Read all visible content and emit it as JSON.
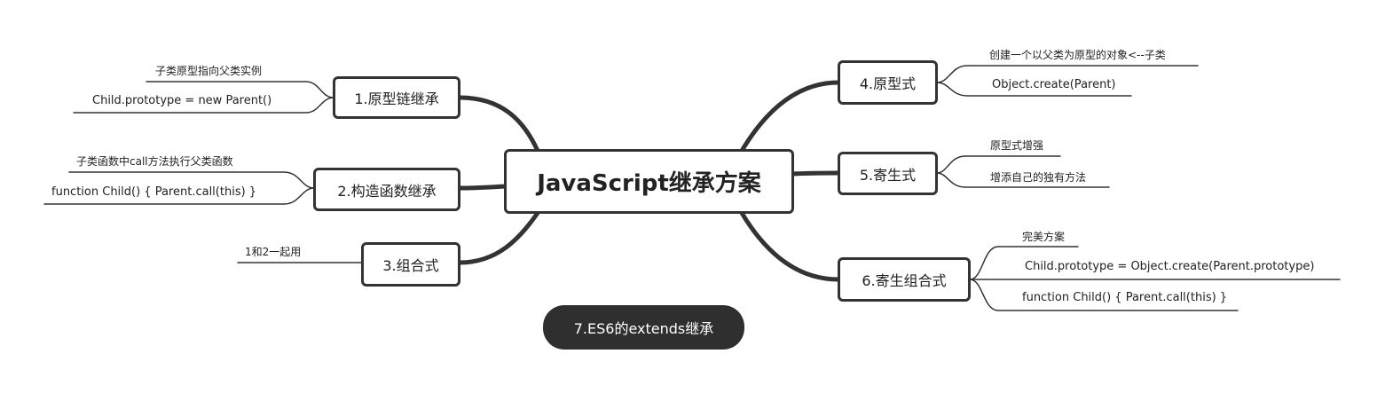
{
  "root": {
    "label": "JavaScript继承方案"
  },
  "branches": {
    "b1": {
      "label": "1.原型链继承",
      "leaves": [
        "子类原型指向父类实例",
        "Child.prototype = new Parent()"
      ]
    },
    "b2": {
      "label": "2.构造函数继承",
      "leaves": [
        "子类函数中call方法执行父类函数",
        "function Child() { Parent.call(this) }"
      ]
    },
    "b3": {
      "label": "3.组合式",
      "leaves": [
        "1和2一起用"
      ]
    },
    "b4": {
      "label": "4.原型式",
      "leaves": [
        "创建一个以父类为原型的对象<--子类",
        "Object.create(Parent)"
      ]
    },
    "b5": {
      "label": "5.寄生式",
      "leaves": [
        "原型式增强",
        "增添自己的独有方法"
      ]
    },
    "b6": {
      "label": "6.寄生组合式",
      "leaves": [
        "完美方案",
        "Child.prototype = Object.create(Parent.prototype)",
        "function Child() { Parent.call(this) }"
      ]
    }
  },
  "floating": {
    "label": "7.ES6的extends继承"
  },
  "colors": {
    "line": "#333333",
    "pill_bg": "#2f2f2f",
    "text": "#222222"
  }
}
